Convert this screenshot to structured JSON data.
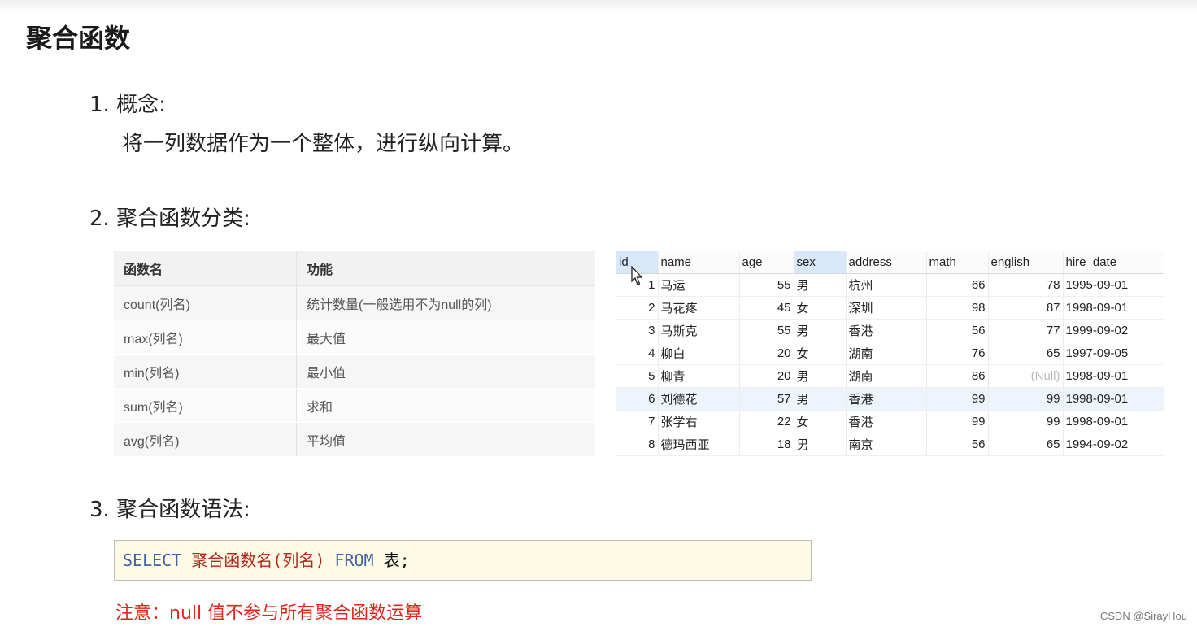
{
  "page_title": "聚合函数",
  "sections": [
    {
      "number": "1.",
      "heading": "概念:",
      "text": "将一列数据作为一个整体，进行纵向计算。"
    },
    {
      "number": "2.",
      "heading": "聚合函数分类:"
    },
    {
      "number": "3.",
      "heading": "聚合函数语法:"
    }
  ],
  "function_table": {
    "headers": [
      "函数名",
      "功能"
    ],
    "rows": [
      [
        "count(列名)",
        "统计数量(一般选用不为null的列)"
      ],
      [
        "max(列名)",
        "最大值"
      ],
      [
        "min(列名)",
        "最小值"
      ],
      [
        "sum(列名)",
        "求和"
      ],
      [
        "avg(列名)",
        "平均值"
      ]
    ]
  },
  "data_grid": {
    "columns": [
      "id",
      "name",
      "age",
      "sex",
      "address",
      "math",
      "english",
      "hire_date"
    ],
    "selected_columns": [
      "id",
      "sex"
    ],
    "highlighted_row": 5,
    "rows": [
      [
        "1",
        "马运",
        "55",
        "男",
        "杭州",
        "66",
        "78",
        "1995-09-01"
      ],
      [
        "2",
        "马花疼",
        "45",
        "女",
        "深圳",
        "98",
        "87",
        "1998-09-01"
      ],
      [
        "3",
        "马斯克",
        "55",
        "男",
        "香港",
        "56",
        "77",
        "1999-09-02"
      ],
      [
        "4",
        "柳白",
        "20",
        "女",
        "湖南",
        "76",
        "65",
        "1997-09-05"
      ],
      [
        "5",
        "柳青",
        "20",
        "男",
        "湖南",
        "86",
        "(Null)",
        "1998-09-01"
      ],
      [
        "6",
        "刘德花",
        "57",
        "男",
        "香港",
        "99",
        "99",
        "1998-09-01"
      ],
      [
        "7",
        "张学右",
        "22",
        "女",
        "香港",
        "99",
        "99",
        "1998-09-01"
      ],
      [
        "8",
        "德玛西亚",
        "18",
        "男",
        "南京",
        "56",
        "65",
        "1994-09-02"
      ]
    ]
  },
  "syntax": {
    "kw_select": "SELECT",
    "func": "聚合函数名(列名)",
    "kw_from": "FROM",
    "table": "表;"
  },
  "note": "注意：null 值不参与所有聚合函数运算",
  "watermark": "CSDN @SirayHou",
  "colors": {
    "keyword": "#3f62a8",
    "function": "#b3261e",
    "note": "#e0261b",
    "code_bg": "#fdfbe5"
  }
}
